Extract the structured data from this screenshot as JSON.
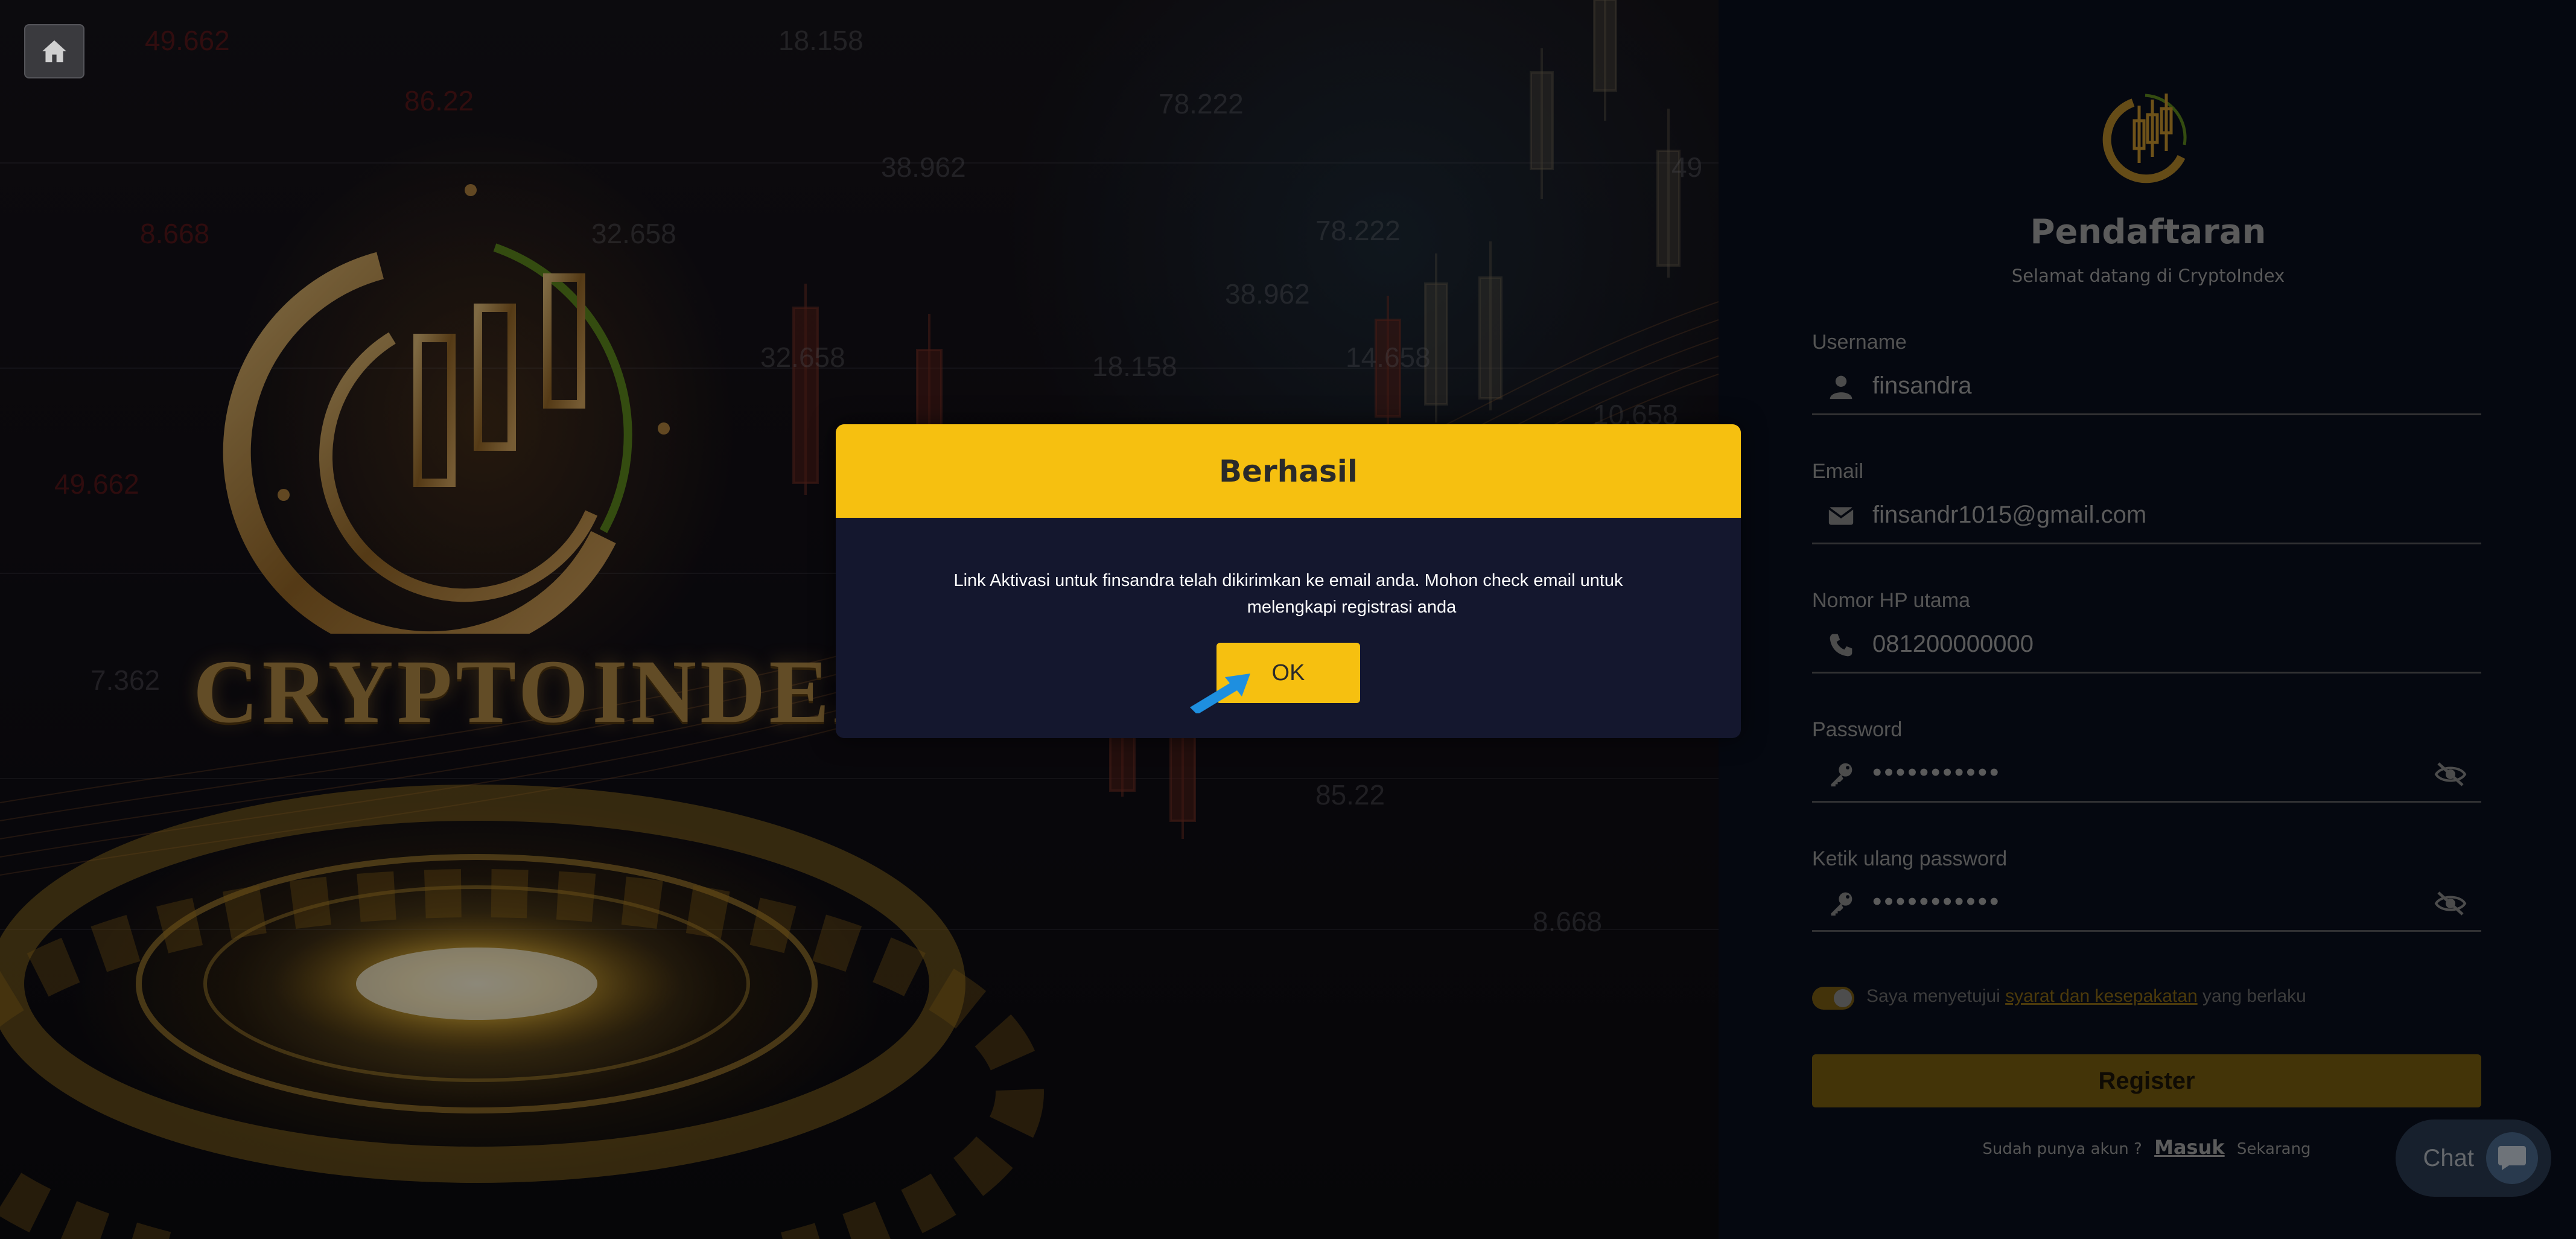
{
  "background": {
    "brand_text": "CRYPTOINDEX",
    "numbers": [
      "49.662",
      "86.22",
      "8.668",
      "32.658",
      "18.158",
      "78.222",
      "38.962",
      "78.222",
      "38.962",
      "18.158",
      "14.658",
      "32.658",
      "10.658",
      "49",
      "49.662",
      "7.362",
      "85.22",
      "8.668"
    ]
  },
  "home_button": {
    "icon": "home-icon"
  },
  "form": {
    "title": "Pendaftaran",
    "subtitle": "Selamat datang di CryptoIndex",
    "username": {
      "label": "Username",
      "value": "finsandra",
      "icon": "user-icon"
    },
    "email": {
      "label": "Email",
      "value": "finsandr1015@gmail.com",
      "icon": "envelope-icon"
    },
    "phone": {
      "label": "Nomor HP utama",
      "value": "081200000000",
      "icon": "phone-icon"
    },
    "password": {
      "label": "Password",
      "value": "•••••••••••",
      "icon": "key-icon"
    },
    "password_confirm": {
      "label": "Ketik ulang password",
      "value": "•••••••••••",
      "icon": "key-icon"
    },
    "agree": {
      "prefix": "Saya menyetujui",
      "link": "syarat dan kesepakatan",
      "suffix": "yang berlaku",
      "checked": true
    },
    "register_label": "Register",
    "login_prefix": "Sudah punya akun ?",
    "login_link": "Masuk",
    "login_suffix": "Sekarang"
  },
  "chat": {
    "label": "Chat",
    "icon": "chat-bubble-icon"
  },
  "dialog": {
    "title": "Berhasil",
    "message_line1": "Link Aktivasi untuk finsandra    telah dikirimkan ke email anda. Mohon check email untuk",
    "message_line2": "melengkapi registrasi anda",
    "ok_label": "OK"
  },
  "colors": {
    "accent_yellow": "#f6c010",
    "panel_bg": "#0a0f1e",
    "dialog_bg": "#14172e"
  }
}
